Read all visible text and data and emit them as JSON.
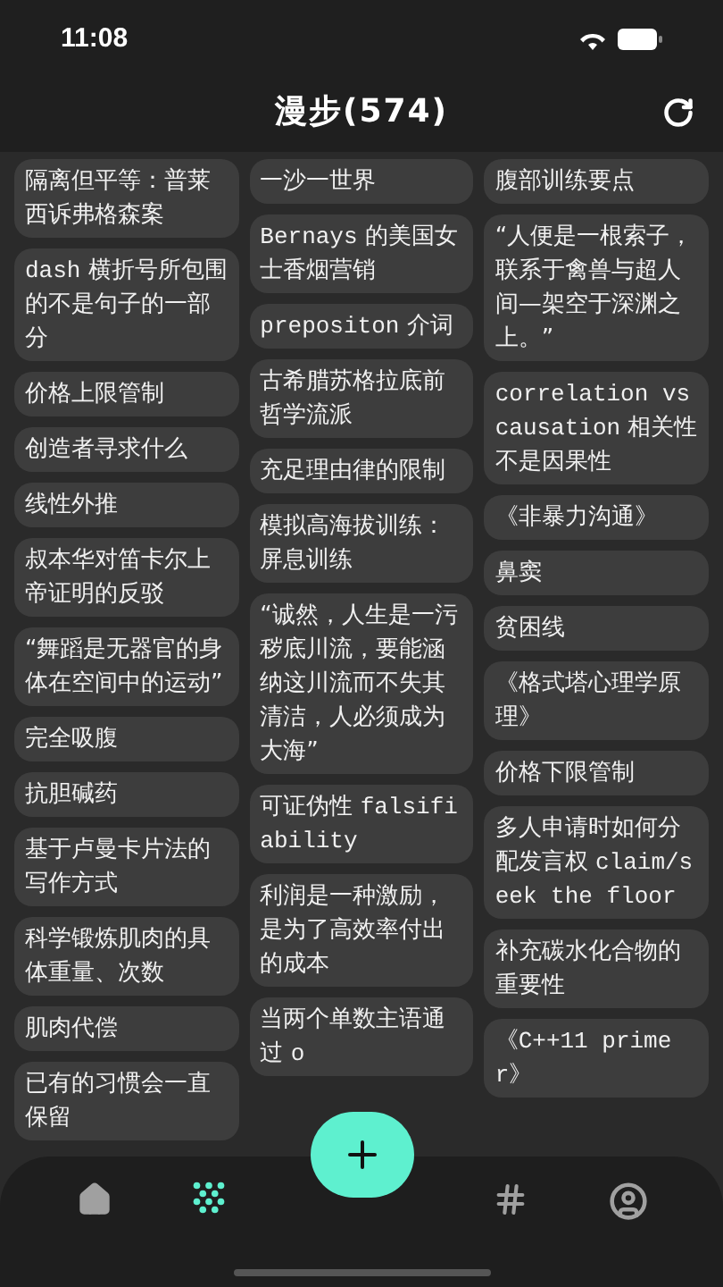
{
  "status_bar": {
    "time": "11:08"
  },
  "header": {
    "title": "漫步(574)"
  },
  "columns": [
    {
      "cards": [
        "隔离但平等：普莱西诉弗格森案",
        "dash 横折号所包围的不是句子的一部分",
        "价格上限管制",
        "创造者寻求什么",
        "线性外推",
        "叔本华对笛卡尔上帝证明的反驳",
        "“舞蹈是无器官的身体在空间中的运动”",
        "完全吸腹",
        "抗胆碱药",
        "基于卢曼卡片法的写作方式",
        "科学锻炼肌肉的具体重量、次数",
        "肌肉代偿",
        "已有的习惯会一直保留"
      ]
    },
    {
      "cards": [
        "一沙一世界",
        "Bernays 的美国女士香烟营销",
        "prepositon 介词",
        "古希腊苏格拉底前哲学流派",
        "充足理由律的限制",
        "模拟高海拔训练：屏息训练",
        "“诚然，人生是一污秽底川流，要能涵纳这川流而不失其清洁，人必须成为大海”",
        "可证伪性 falsifiability",
        "利润是一种激励，是为了高效率付出的成本",
        "当两个单数主语通过 o"
      ]
    },
    {
      "cards": [
        "腹部训练要点",
        "“人便是一根索子，联系于禽兽与超人间—架空于深渊之上。”",
        "correlation vs causation 相关性不是因果性",
        "《非暴力沟通》",
        "鼻窦",
        "贫困线",
        "《格式塔心理学原理》",
        "价格下限管制",
        "多人申请时如何分配发言权 claim/seek the floor",
        "补充碳水化合物的重要性",
        "《C++11 primer》"
      ]
    }
  ],
  "nav": [
    {
      "kind": "home",
      "selected": false
    },
    {
      "kind": "dots",
      "selected": true
    },
    {
      "kind": "add",
      "selected": false
    },
    {
      "kind": "hash",
      "selected": false
    },
    {
      "kind": "profile",
      "selected": false
    }
  ]
}
